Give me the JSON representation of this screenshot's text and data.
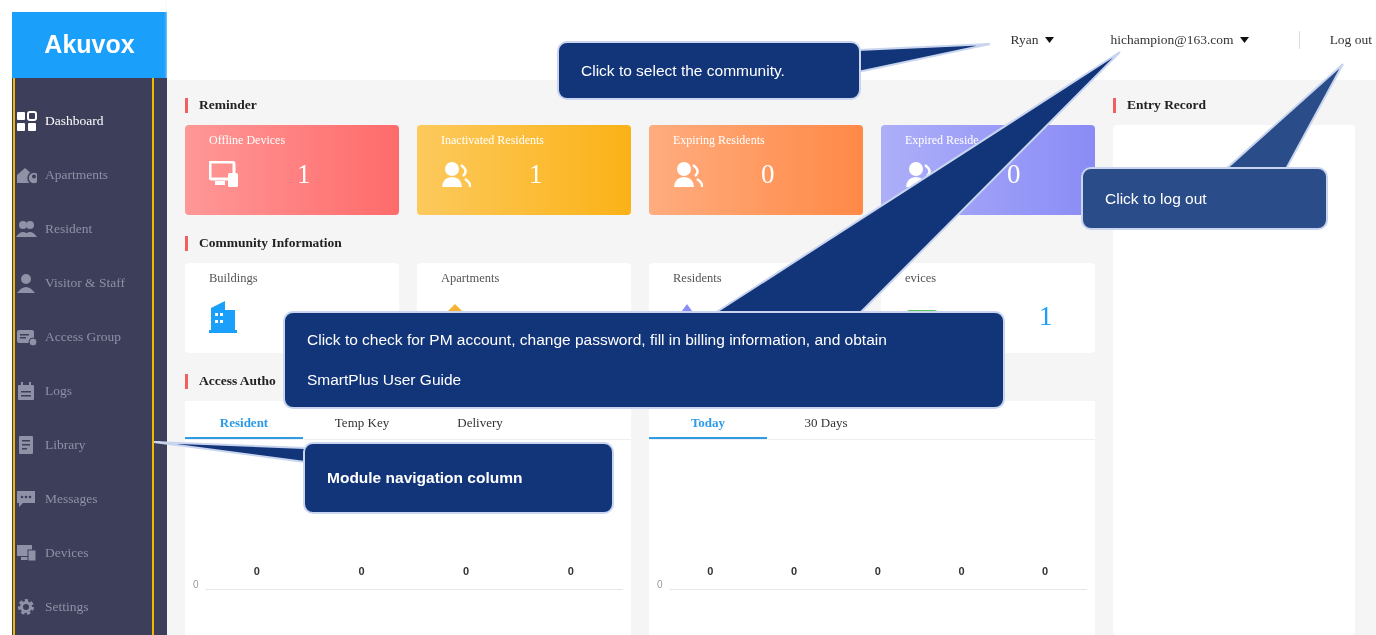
{
  "logo": "Akuvox",
  "sidebar": {
    "items": [
      {
        "label": "Dashboard",
        "selected": true
      },
      {
        "label": "Apartments",
        "selected": false
      },
      {
        "label": "Resident",
        "selected": false
      },
      {
        "label": "Visitor & Staff",
        "selected": false
      },
      {
        "label": "Access Group",
        "selected": false
      },
      {
        "label": "Logs",
        "selected": false
      },
      {
        "label": "Library",
        "selected": false
      },
      {
        "label": "Messages",
        "selected": false
      },
      {
        "label": "Devices",
        "selected": false
      },
      {
        "label": "Settings",
        "selected": false
      }
    ]
  },
  "header": {
    "community": "Ryan",
    "account": "hichampion@163.com",
    "logout": "Log out"
  },
  "reminder": {
    "title": "Reminder",
    "cards": [
      {
        "label": "Offline Devices",
        "value": "1",
        "color": "#ff6b6b"
      },
      {
        "label": "Inactivated Residents",
        "value": "1",
        "color": "#fbb217"
      },
      {
        "label": "Expiring Residents",
        "value": "0",
        "color": "#ff8947"
      },
      {
        "label": "Expired Reside",
        "value": "0",
        "color": "#8a8cf6"
      }
    ]
  },
  "community_info": {
    "title": "Community Information",
    "cards": [
      {
        "label": "Buildings"
      },
      {
        "label": "Apartments"
      },
      {
        "label": "Residents"
      },
      {
        "label": "evices",
        "value": "1"
      }
    ]
  },
  "access": {
    "title": "Access Autho",
    "tabs": [
      {
        "label": "Resident",
        "selected": true
      },
      {
        "label": "Temp Key",
        "selected": false
      },
      {
        "label": "Delivery",
        "selected": false
      }
    ],
    "axis_label": "0",
    "value_labels": [
      "0",
      "0",
      "0",
      "0"
    ]
  },
  "entries": {
    "tabs": [
      {
        "label": "Today",
        "selected": true
      },
      {
        "label": "30 Days",
        "selected": false
      }
    ],
    "axis_label": "0",
    "value_labels": [
      "0",
      "0",
      "0",
      "0",
      "0"
    ]
  },
  "entry_record": {
    "title": "Entry Record"
  },
  "callouts": [
    {
      "text": "Click to select the community.",
      "bold": false,
      "color": "#12357a"
    },
    {
      "text": "Click to log out",
      "bold": false,
      "color": "#2a4c88"
    },
    {
      "text": "Click to check for PM account, change password, fill in billing information, and obtain SmartPlus User Guide",
      "bold": false,
      "color": "#12357a"
    },
    {
      "text": "Module navigation column",
      "bold": true,
      "color": "#12357a"
    }
  ]
}
